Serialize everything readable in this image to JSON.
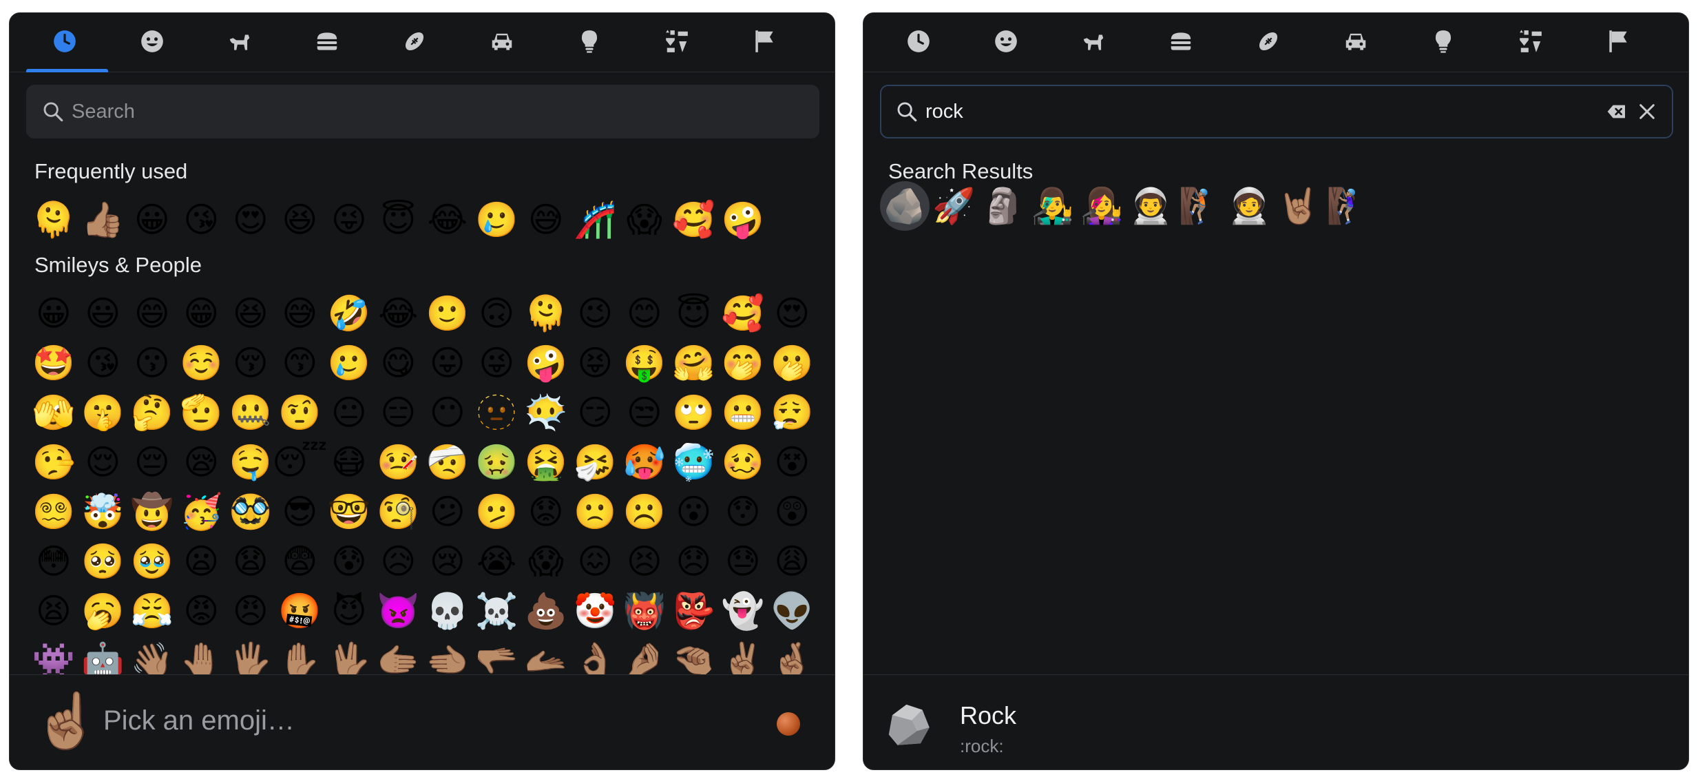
{
  "categories": [
    "recent",
    "smileys",
    "animals",
    "food",
    "activities",
    "travel",
    "objects",
    "symbols",
    "flags"
  ],
  "colors": {
    "accent": "#2f80ed",
    "icon": "#c9cacc",
    "icon_active": "#2f80ed",
    "panel_bg": "#151617"
  },
  "left": {
    "active_category": "recent",
    "search": {
      "placeholder": "Search",
      "value": ""
    },
    "frequently_used_title": "Frequently used",
    "frequently_used": [
      "🫠",
      "👍🏽",
      "😀",
      "😘",
      "😍",
      "😆",
      "😜",
      "😇",
      "😂",
      "🥲",
      "😅",
      "🎢",
      "😱",
      "🥰",
      "🤪"
    ],
    "smileys_title": "Smileys & People",
    "smileys": [
      "😀",
      "😃",
      "😄",
      "😁",
      "😆",
      "😅",
      "🤣",
      "😂",
      "🙂",
      "🙃",
      "🫠",
      "😉",
      "😊",
      "😇",
      "🥰",
      "😍",
      "🤩",
      "😘",
      "😗",
      "☺️",
      "😚",
      "😙",
      "🥲",
      "😋",
      "😛",
      "😜",
      "🤪",
      "😝",
      "🤑",
      "🤗",
      "🤭",
      "🫢",
      "🫣",
      "🤫",
      "🤔",
      "🫡",
      "🤐",
      "🤨",
      "😐",
      "😑",
      "😶",
      "🫥",
      "😶‍🌫️",
      "😏",
      "😒",
      "🙄",
      "😬",
      "😮‍💨",
      "🤥",
      "😌",
      "😔",
      "😪",
      "🤤",
      "😴",
      "😷",
      "🤒",
      "🤕",
      "🤢",
      "🤮",
      "🤧",
      "🥵",
      "🥶",
      "🥴",
      "😵",
      "😵‍💫",
      "🤯",
      "🤠",
      "🥳",
      "🥸",
      "😎",
      "🤓",
      "🧐",
      "😕",
      "🫤",
      "😟",
      "🙁",
      "☹️",
      "😮",
      "😯",
      "😲",
      "😳",
      "🥺",
      "🥹",
      "😦",
      "😧",
      "😨",
      "😰",
      "😥",
      "😢",
      "😭",
      "😱",
      "😖",
      "😣",
      "😞",
      "😓",
      "😩",
      "😫",
      "🥱",
      "😤",
      "😡",
      "😠",
      "🤬",
      "😈",
      "👿",
      "💀",
      "☠️",
      "💩",
      "🤡",
      "👹",
      "👺",
      "👻",
      "👽",
      "👾",
      "🤖",
      "👋🏽",
      "🤚🏽",
      "🖐🏽",
      "✋🏽",
      "🖖🏽",
      "🫱🏽",
      "🫲🏽",
      "🫳🏽",
      "🫴🏽",
      "👌🏽",
      "🤌🏽",
      "🤏🏽",
      "✌🏽",
      "🤞🏽"
    ],
    "preview": {
      "emoji": "☝🏽",
      "placeholder": "Pick an emoji…"
    }
  },
  "right": {
    "search": {
      "placeholder": "Search",
      "value": "rock"
    },
    "results_title": "Search Results",
    "results": [
      "🪨",
      "🚀",
      "🗿",
      "👨‍🎤",
      "👩‍🎤",
      "👨‍🚀",
      "🧗🏽",
      "🧑‍🚀",
      "🤘🏽",
      "🧗🏽‍♀️"
    ],
    "selected_index": 0,
    "preview": {
      "name": "Rock",
      "code": ":rock:"
    }
  }
}
